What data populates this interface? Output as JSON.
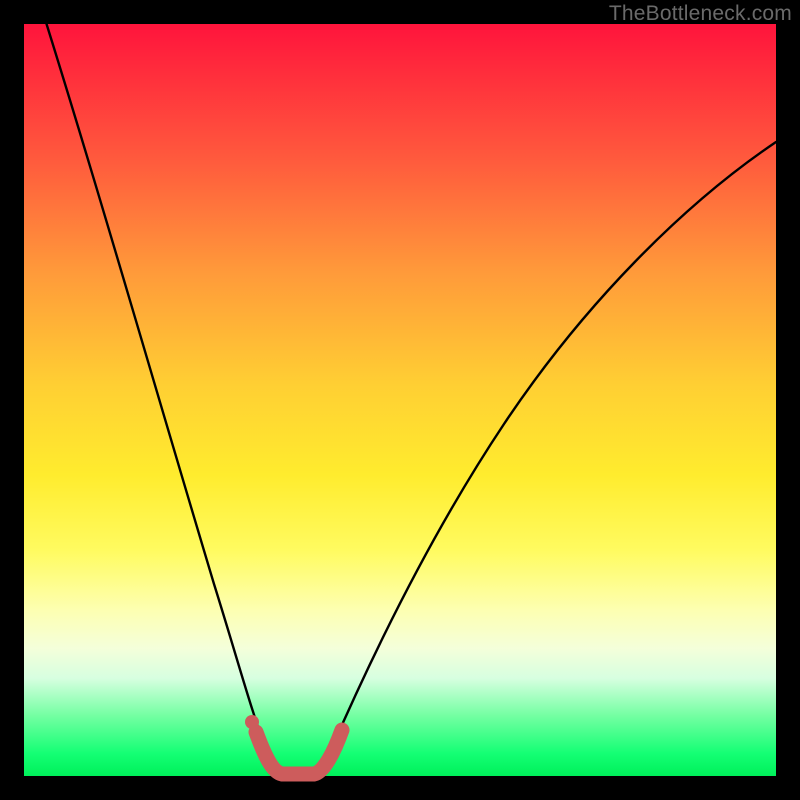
{
  "watermark": "TheBottleneck.com",
  "chart_data": {
    "type": "line",
    "title": "",
    "xlabel": "",
    "ylabel": "",
    "xlim": [
      0,
      100
    ],
    "ylim": [
      0,
      100
    ],
    "series": [
      {
        "name": "bottleneck-curve",
        "x": [
          0,
          4,
          8,
          12,
          16,
          20,
          24,
          27,
          30,
          32,
          34,
          36,
          38,
          40,
          44,
          50,
          58,
          66,
          76,
          88,
          100
        ],
        "y": [
          106,
          89,
          72,
          56,
          41,
          28,
          16,
          8,
          3,
          0.8,
          0,
          0,
          0.8,
          3,
          10,
          22,
          37,
          50,
          62,
          73,
          82
        ]
      },
      {
        "name": "bottleneck-highlight",
        "x": [
          29.5,
          31,
          32,
          33,
          34,
          35,
          36,
          37,
          38,
          39,
          40
        ],
        "y": [
          3.2,
          1.2,
          0.5,
          0,
          0,
          0,
          0,
          0.5,
          1.2,
          2.2,
          3.5
        ]
      }
    ],
    "gradient_bands": [
      {
        "pos": 0,
        "color": "#ff143c"
      },
      {
        "pos": 18,
        "color": "#ff5a3d"
      },
      {
        "pos": 33,
        "color": "#ff9a3a"
      },
      {
        "pos": 48,
        "color": "#ffcf33"
      },
      {
        "pos": 60,
        "color": "#ffec2e"
      },
      {
        "pos": 70,
        "color": "#fffb60"
      },
      {
        "pos": 78,
        "color": "#fdffb2"
      },
      {
        "pos": 83,
        "color": "#f4ffda"
      },
      {
        "pos": 87,
        "color": "#d7ffe0"
      },
      {
        "pos": 92,
        "color": "#73ffa2"
      },
      {
        "pos": 97,
        "color": "#14ff74"
      },
      {
        "pos": 100,
        "color": "#00f05a"
      }
    ],
    "highlight_color": "#cd5c5c",
    "curve_color": "#000000"
  }
}
